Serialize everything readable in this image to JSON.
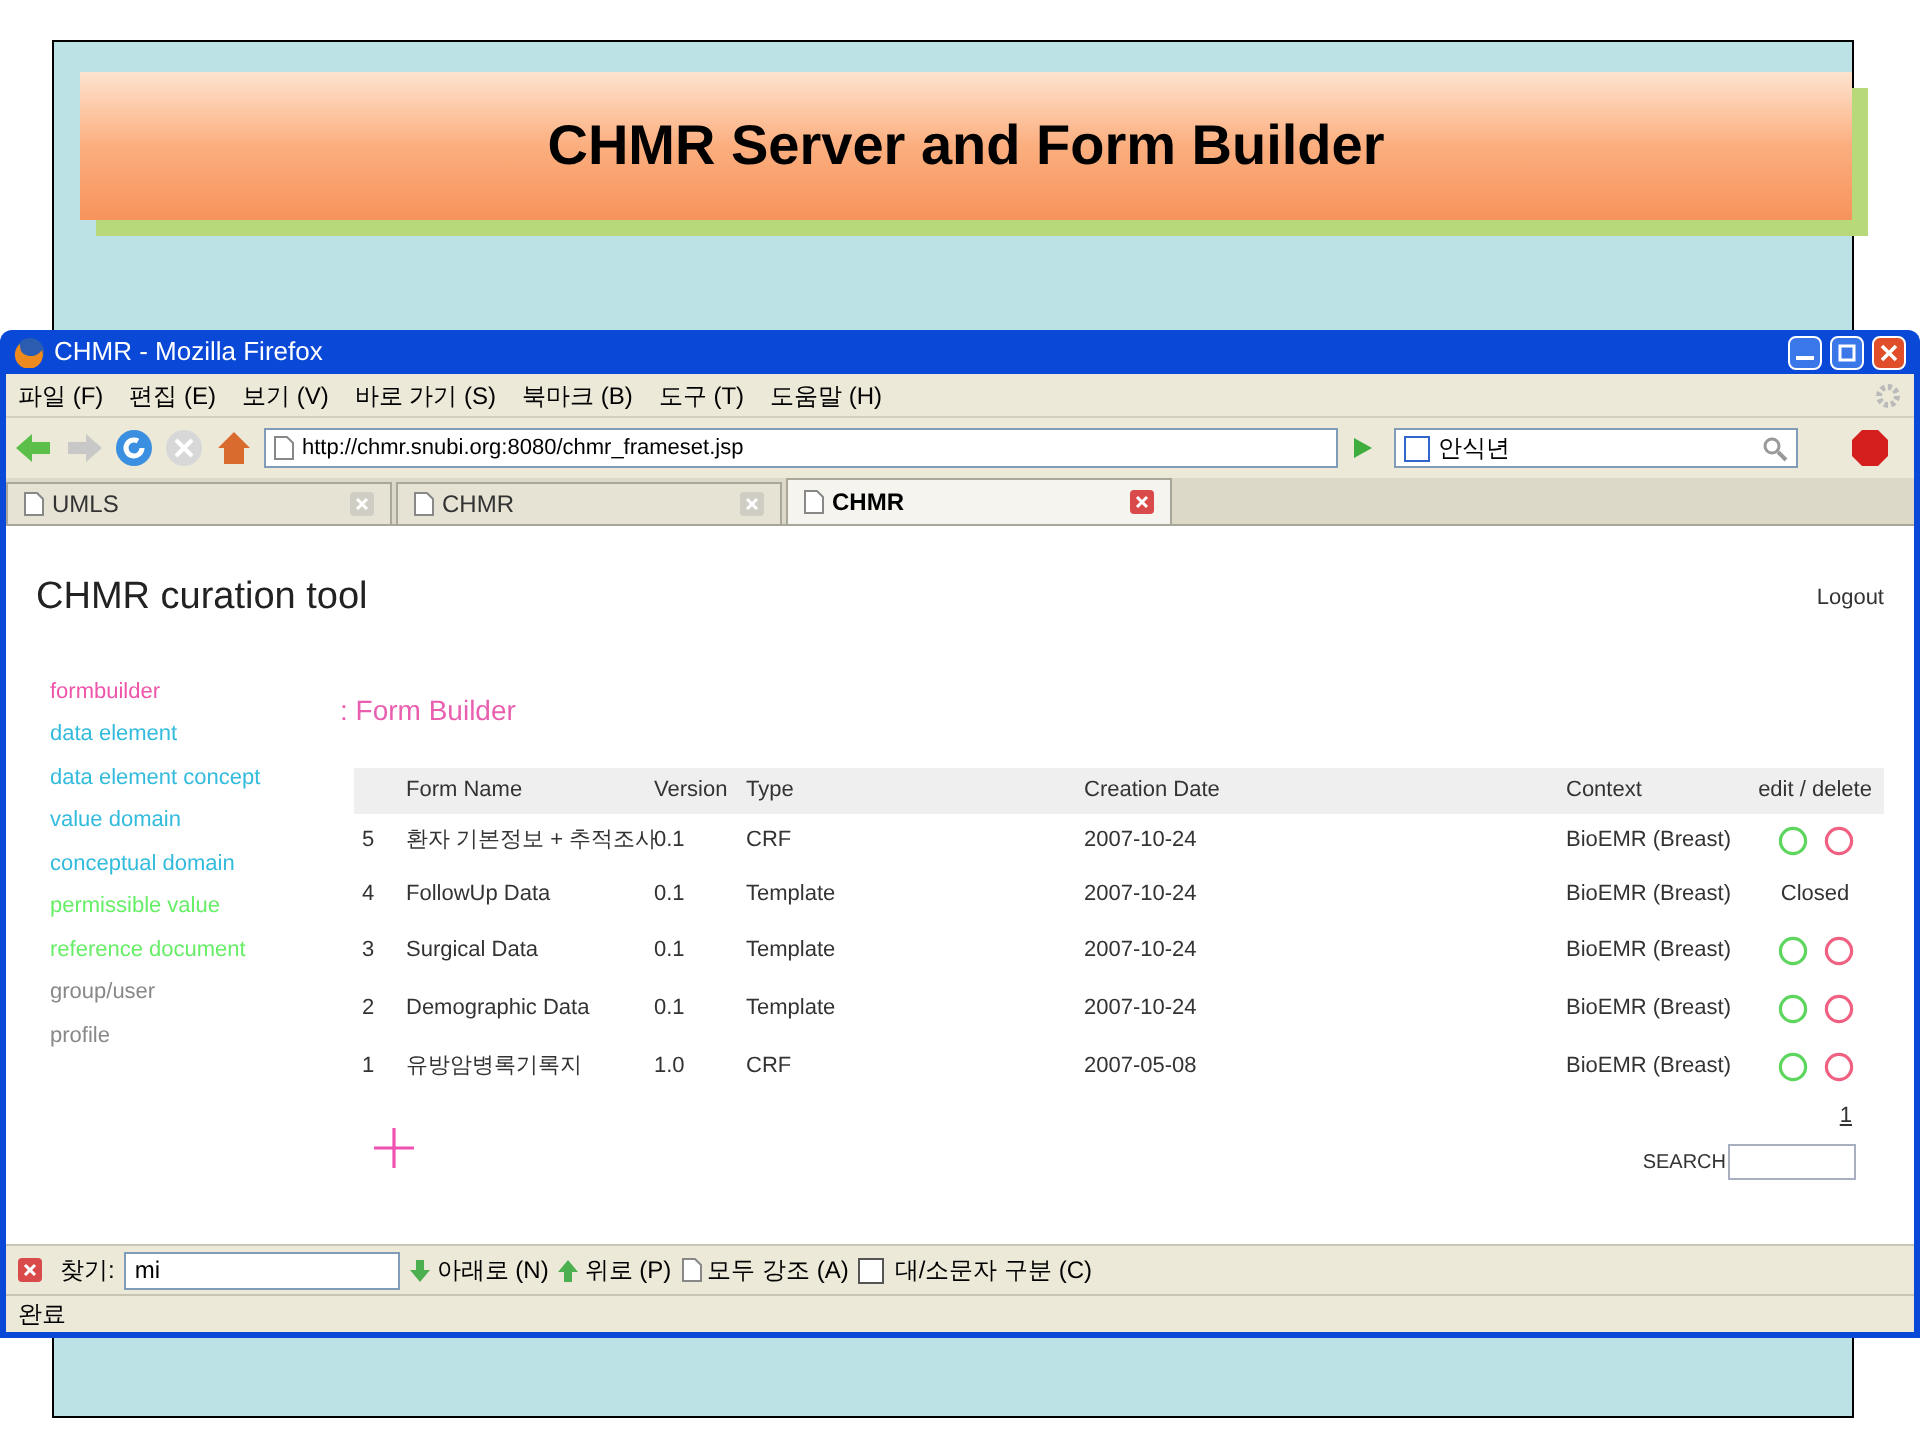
{
  "slide_title": "CHMR Server and Form Builder",
  "window": {
    "title": "CHMR - Mozilla Firefox"
  },
  "menu": [
    "파일 (F)",
    "편집 (E)",
    "보기 (V)",
    "바로 가기 (S)",
    "북마크 (B)",
    "도구 (T)",
    "도움말 (H)"
  ],
  "address": "http://chmr.snubi.org:8080/chmr_frameset.jsp",
  "search_box": "안식년",
  "tabs": [
    {
      "label": "UMLS",
      "selected": false
    },
    {
      "label": "CHMR",
      "selected": false
    },
    {
      "label": "CHMR",
      "selected": true
    }
  ],
  "page": {
    "title": "CHMR curation tool",
    "logout": "Logout",
    "sidebar": [
      {
        "label": "formbuilder",
        "color": "#ee55aa"
      },
      {
        "label": "data element",
        "color": "#33bbdd"
      },
      {
        "label": "data element concept",
        "color": "#33bbdd"
      },
      {
        "label": "value domain",
        "color": "#33bbdd"
      },
      {
        "label": "conceptual domain",
        "color": "#33bbdd"
      },
      {
        "label": "permissible value",
        "color": "#66ee66"
      },
      {
        "label": "reference document",
        "color": "#66ee66"
      },
      {
        "label": "group/user",
        "color": "#888888"
      },
      {
        "label": "profile",
        "color": "#888888"
      }
    ],
    "section_title": ": Form Builder",
    "table": {
      "columns": [
        "",
        "Form Name",
        "Version",
        "Type",
        "Creation Date",
        "Context",
        "edit / delete"
      ],
      "rows": [
        {
          "num": "5",
          "name": "환자 기본정보 + 추적조사",
          "version": "0.1",
          "type": "CRF",
          "date": "2007-10-24",
          "context": "BioEMR (Breast)",
          "kind": "icons"
        },
        {
          "num": "4",
          "name": "FollowUp Data",
          "version": "0.1",
          "type": "Template",
          "date": "2007-10-24",
          "context": "BioEMR (Breast)",
          "kind": "text",
          "status": "Closed"
        },
        {
          "num": "3",
          "name": "Surgical Data",
          "version": "0.1",
          "type": "Template",
          "date": "2007-10-24",
          "context": "BioEMR (Breast)",
          "kind": "icons"
        },
        {
          "num": "2",
          "name": "Demographic Data",
          "version": "0.1",
          "type": "Template",
          "date": "2007-10-24",
          "context": "BioEMR (Breast)",
          "kind": "icons"
        },
        {
          "num": "1",
          "name": "유방암병록기록지",
          "version": "1.0",
          "type": "CRF",
          "date": "2007-05-08",
          "context": "BioEMR (Breast)",
          "kind": "icons"
        }
      ]
    },
    "pager": "1",
    "search_label": "SEARCH"
  },
  "find_bar": {
    "label": "찾기:",
    "value": "mi",
    "next": "아래로 (N)",
    "prev": "위로 (P)",
    "highlight": "모두 강조 (A)",
    "match_case": {
      "label": "대/소문자 구분 (C)",
      "checked": false
    }
  },
  "status_bar": "완료"
}
